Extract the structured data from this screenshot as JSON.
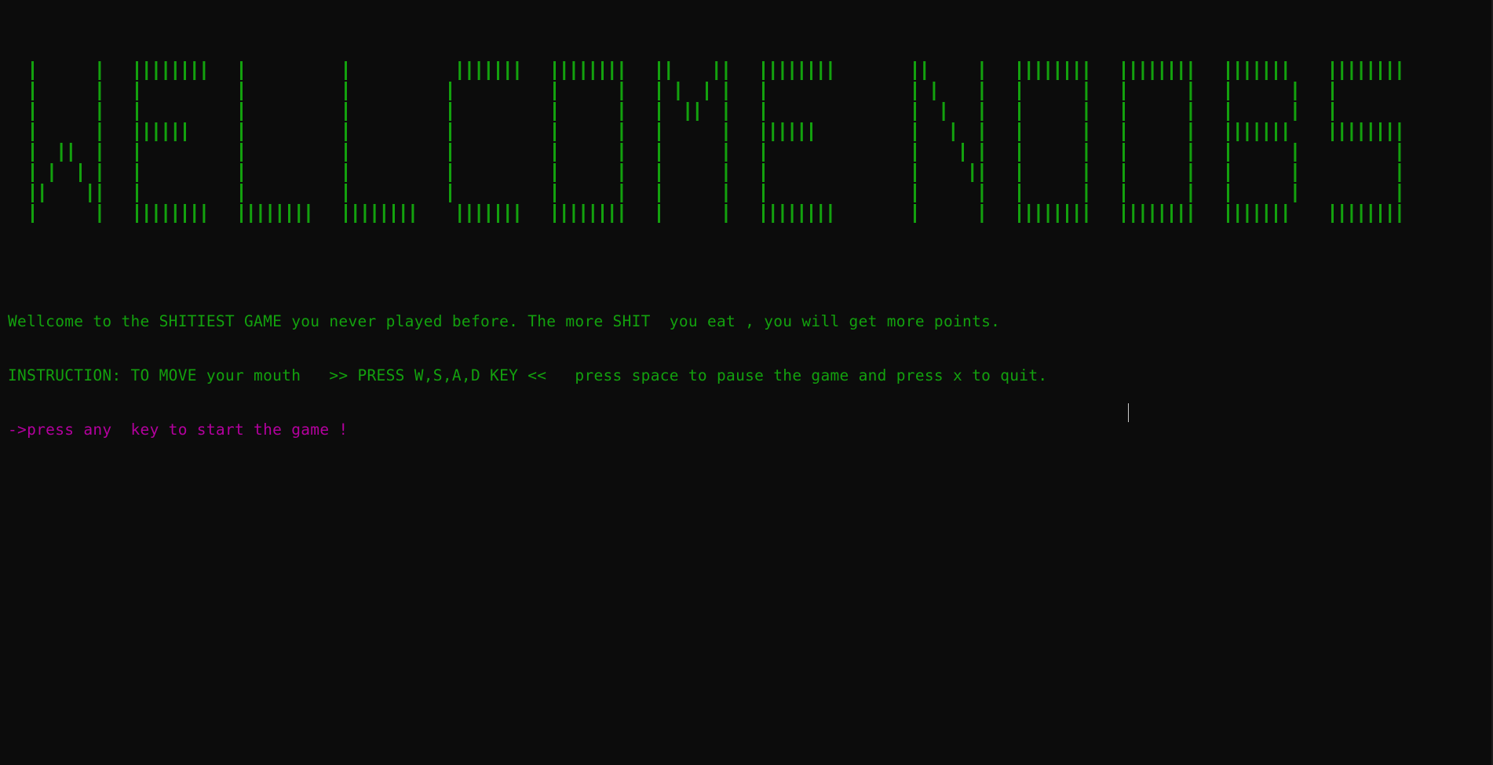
{
  "banner": {
    "text": "WELLCOME NOOBS",
    "color": "#13a10e"
  },
  "messages": {
    "welcome": "Wellcome to the SHITIEST GAME you never played before. The more SHIT  you eat , you will get more points.",
    "instruction": "INSTRUCTION: TO MOVE your mouth   >> PRESS W,S,A,D KEY <<   press space to pause the game and press x to quit.",
    "prompt": "->press any  key to start the game !"
  },
  "colors": {
    "background": "#0c0c0c",
    "text_green": "#13a10e",
    "text_magenta": "#b4009e",
    "cursor": "#cccccc"
  }
}
